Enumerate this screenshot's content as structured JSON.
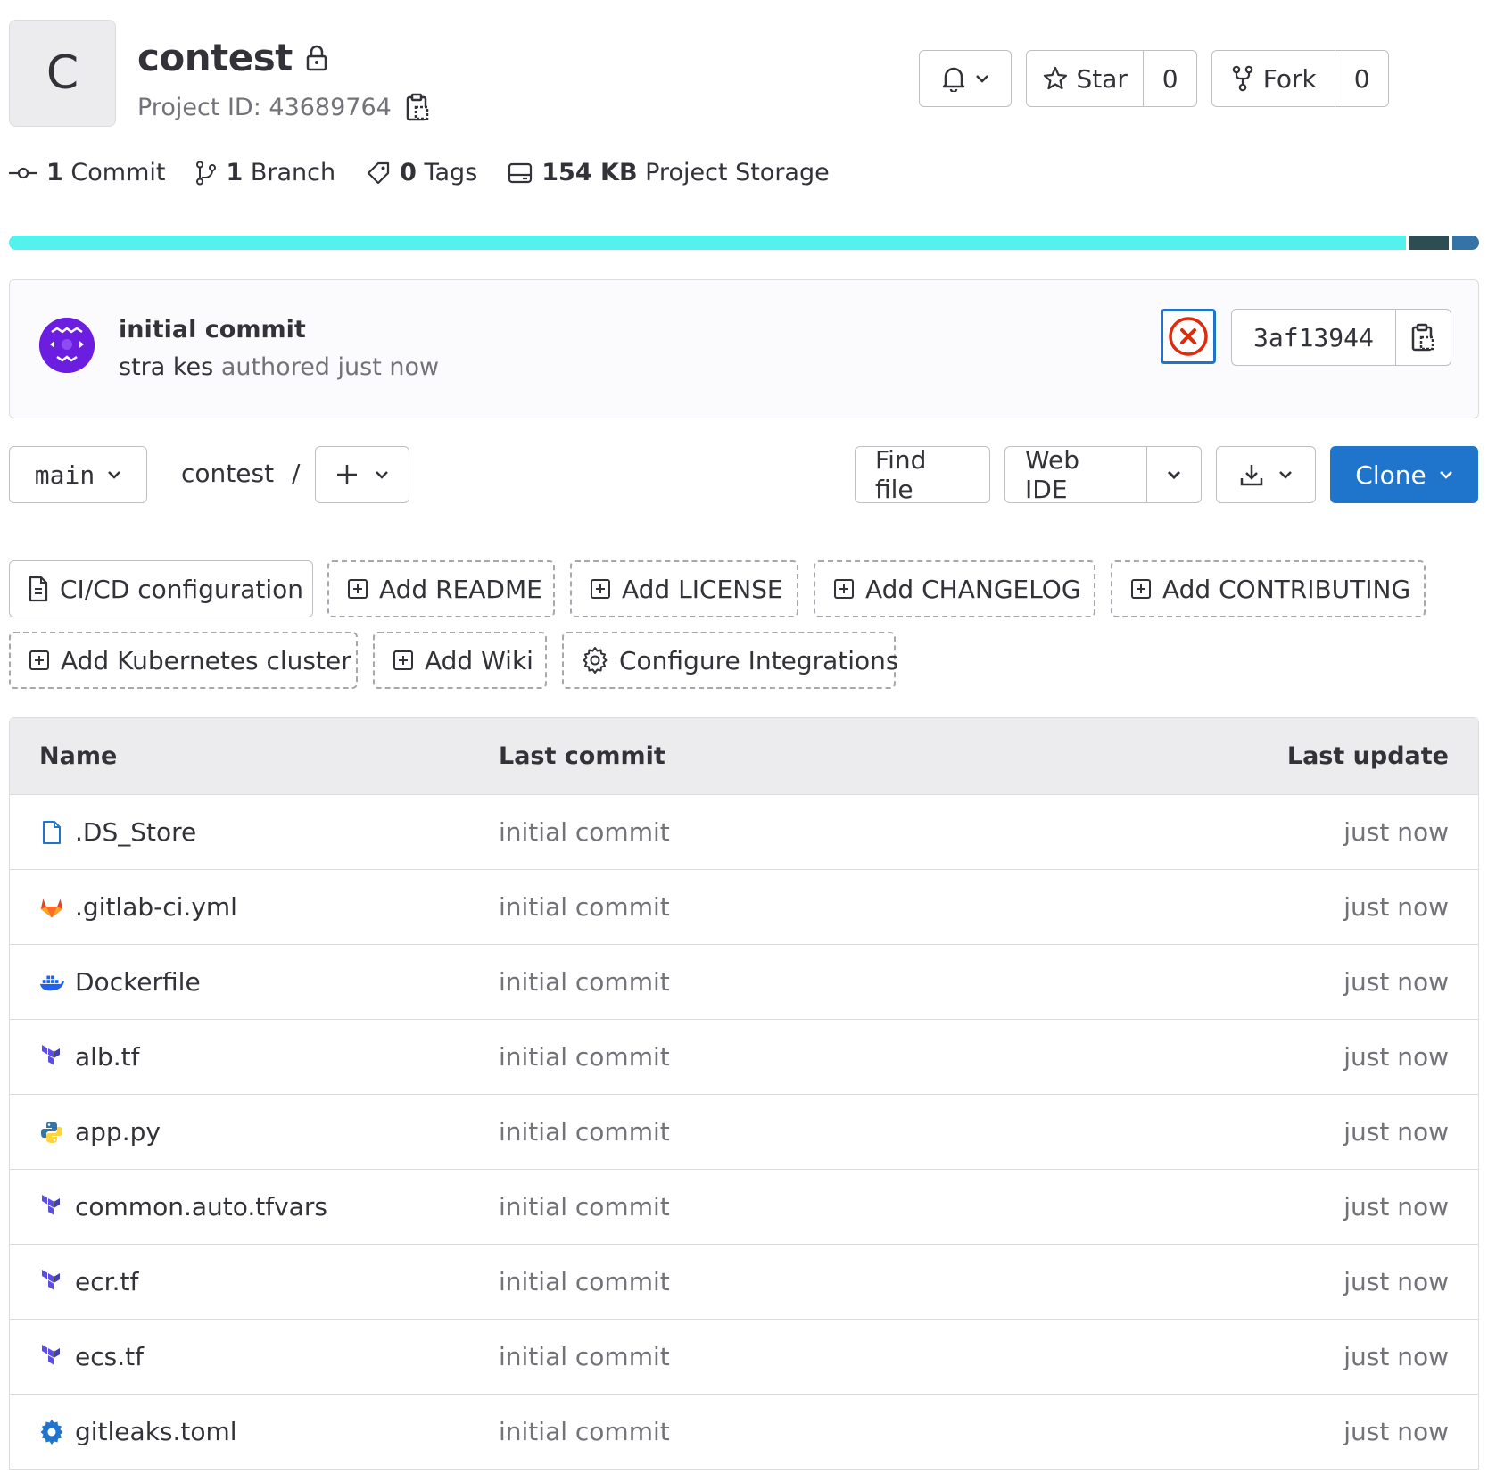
{
  "project": {
    "avatar_letter": "C",
    "name": "contest",
    "id_label": "Project ID: 43689764"
  },
  "header_actions": {
    "star_label": "Star",
    "star_count": "0",
    "fork_label": "Fork",
    "fork_count": "0"
  },
  "stats": {
    "commits_count": "1",
    "commits_label": "Commit",
    "branches_count": "1",
    "branches_label": "Branch",
    "tags_count": "0",
    "tags_label": "Tags",
    "storage_value": "154 KB",
    "storage_label": "Project Storage"
  },
  "language_bar": [
    {
      "color": "#54f2ec",
      "share": 0.955
    },
    {
      "color": "#2e4d52",
      "share": 0.027
    },
    {
      "color": "#3572a5",
      "share": 0.018
    }
  ],
  "last_commit": {
    "title": "initial commit",
    "author": "stra kes",
    "meta": " authored just now",
    "sha": "3af13944",
    "pipeline_status": "failed"
  },
  "tree": {
    "branch": "main",
    "path_root": "contest",
    "path_sep": "/",
    "find_file": "Find file",
    "web_ide": "Web IDE",
    "clone": "Clone"
  },
  "quick_actions": {
    "cicd": "CI/CD configuration",
    "readme": "Add README",
    "license": "Add LICENSE",
    "changelog": "Add CHANGELOG",
    "contributing": "Add CONTRIBUTING",
    "kubernetes": "Add Kubernetes cluster",
    "wiki": "Add Wiki",
    "integrations": "Configure Integrations"
  },
  "table": {
    "headers": {
      "name": "Name",
      "last_commit": "Last commit",
      "last_update": "Last update"
    },
    "rows": [
      {
        "name": ".DS_Store",
        "icon": "file-icon",
        "commit": "initial commit",
        "updated": "just now"
      },
      {
        "name": ".gitlab-ci.yml",
        "icon": "gitlab-icon",
        "commit": "initial commit",
        "updated": "just now"
      },
      {
        "name": "Dockerfile",
        "icon": "docker-icon",
        "commit": "initial commit",
        "updated": "just now"
      },
      {
        "name": "alb.tf",
        "icon": "terraform-icon",
        "commit": "initial commit",
        "updated": "just now"
      },
      {
        "name": "app.py",
        "icon": "python-icon",
        "commit": "initial commit",
        "updated": "just now"
      },
      {
        "name": "common.auto.tfvars",
        "icon": "terraform-icon",
        "commit": "initial commit",
        "updated": "just now"
      },
      {
        "name": "ecr.tf",
        "icon": "terraform-icon",
        "commit": "initial commit",
        "updated": "just now"
      },
      {
        "name": "ecs.tf",
        "icon": "terraform-icon",
        "commit": "initial commit",
        "updated": "just now"
      },
      {
        "name": "gitleaks.toml",
        "icon": "gear-file-icon",
        "commit": "initial commit",
        "updated": "just now"
      }
    ]
  }
}
